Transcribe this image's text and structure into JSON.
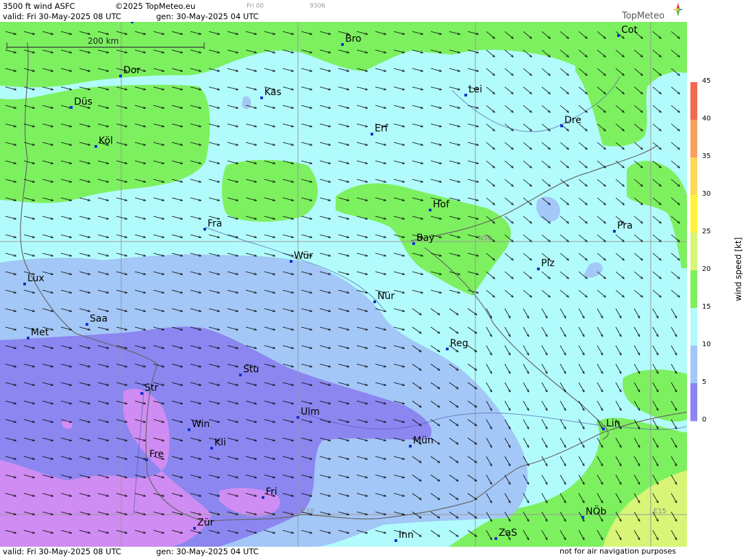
{
  "header": {
    "product": "3500 ft wind ASFC",
    "copyright": "©2025 TopMeteo.eu",
    "faint_run": "Fri 00",
    "faint_code": "9306",
    "valid": "valid:  Fri  30-May-2025  08 UTC",
    "gen": "gen: 30-May-2025 04 UTC",
    "logo": "TopMeteo"
  },
  "footer": {
    "valid": "valid:  Fri  30-May-2025  08 UTC",
    "gen": "gen: 30-May-2025 04 UTC",
    "disclaimer": "not for air navigation purposes"
  },
  "scale_bar": {
    "label": "200 km"
  },
  "grid_labels": {
    "n50": "N50",
    "e10": "E10",
    "e15": "E15"
  },
  "legend": {
    "title": "wind speed [kt]",
    "ticks": [
      "45",
      "40",
      "35",
      "30",
      "25",
      "20",
      "15",
      "10",
      "5",
      "0"
    ],
    "colors": [
      "#f06a50",
      "#f7a060",
      "#fbd855",
      "#fff33a",
      "#d8f577",
      "#7df060",
      "#b2fbfc",
      "#a3c7f7",
      "#8c86f0",
      "#cf8cf2"
    ]
  },
  "cities": [
    {
      "name": "Mün",
      "label": "Mün"
    },
    {
      "name": "Bro",
      "label": "Bro"
    },
    {
      "name": "Cot",
      "label": "Cot"
    },
    {
      "name": "Dor",
      "label": "Dor"
    },
    {
      "name": "Kas",
      "label": "Kas"
    },
    {
      "name": "Lei",
      "label": "Lei"
    },
    {
      "name": "Düs",
      "label": "Düs"
    },
    {
      "name": "Erf",
      "label": "Erf"
    },
    {
      "name": "Dre",
      "label": "Dre"
    },
    {
      "name": "Köl",
      "label": "Köl"
    },
    {
      "name": "Hof",
      "label": "Hof"
    },
    {
      "name": "Fra",
      "label": "Fra"
    },
    {
      "name": "Pra",
      "label": "Pra"
    },
    {
      "name": "Bay",
      "label": "Bay"
    },
    {
      "name": "Würz",
      "label": "Wür"
    },
    {
      "name": "Plz",
      "label": "Plz"
    },
    {
      "name": "Lux",
      "label": "Lux"
    },
    {
      "name": "Nür",
      "label": "Nür"
    },
    {
      "name": "Saa",
      "label": "Saa"
    },
    {
      "name": "Met",
      "label": "Met"
    },
    {
      "name": "Reg",
      "label": "Reg"
    },
    {
      "name": "Stu",
      "label": "Stu"
    },
    {
      "name": "Str",
      "label": "Str"
    },
    {
      "name": "Ulm",
      "label": "Ulm"
    },
    {
      "name": "Win",
      "label": "Win"
    },
    {
      "name": "Mün2",
      "label": "Mün"
    },
    {
      "name": "Lin",
      "label": "Lin"
    },
    {
      "name": "Kli",
      "label": "Kli"
    },
    {
      "name": "Fre",
      "label": "Fre"
    },
    {
      "name": "Fri",
      "label": "Fri"
    },
    {
      "name": "NÖb",
      "label": "NÖb"
    },
    {
      "name": "Zür",
      "label": "Zür"
    },
    {
      "name": "Inn",
      "label": "Inn"
    },
    {
      "name": "ZaS",
      "label": "ZaS"
    }
  ]
}
